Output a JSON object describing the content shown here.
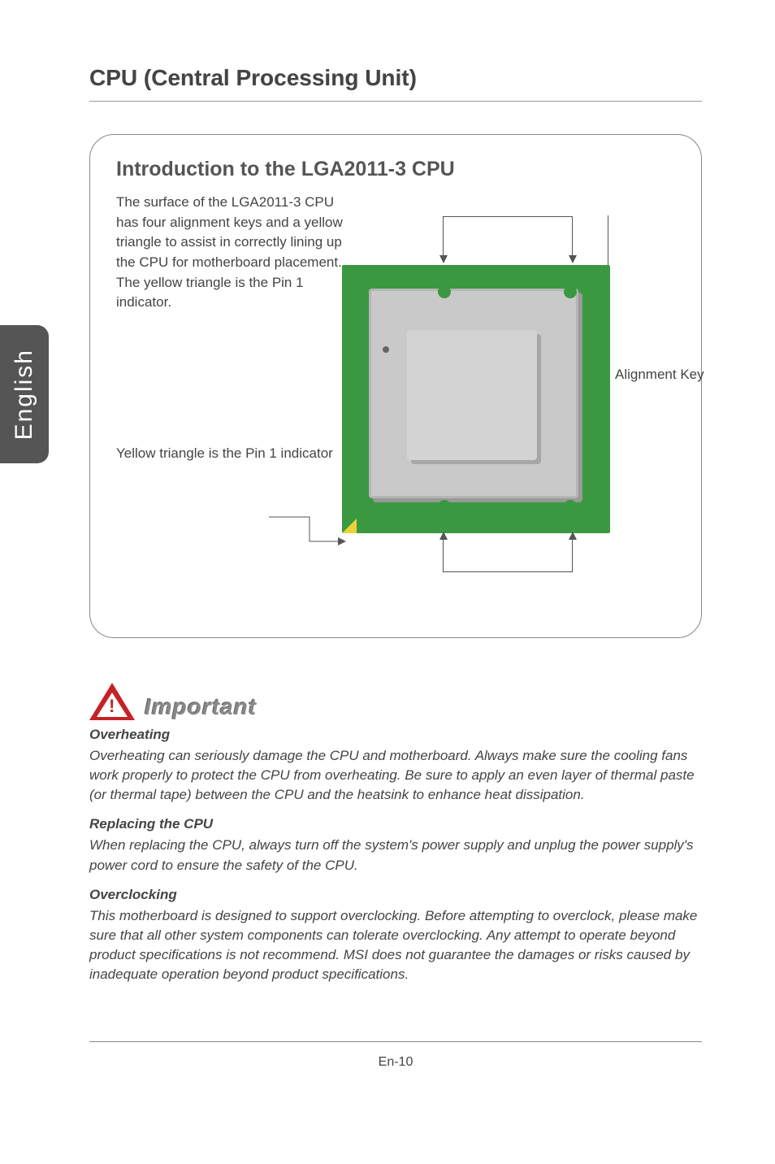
{
  "side_tab": "English",
  "section_title": "CPU (Central Processing Unit)",
  "card": {
    "title": "Introduction to the LGA2011-3 CPU",
    "desc": "The surface of the LGA2011-3 CPU has four alignment keys and a yellow triangle to assist in correctly lining up the CPU for motherboard placement. The yellow triangle is the Pin 1 indicator.",
    "pin_note": "Yellow triangle is the Pin 1 indicator",
    "align_label": "Alignment  Key"
  },
  "important": {
    "header": "Important",
    "sections": [
      {
        "heading": "Overheating",
        "body": "Overheating can seriously damage the CPU and motherboard. Always make sure the cooling fans work properly to protect the CPU from overheating. Be sure to apply an even layer of thermal paste (or thermal tape) between the CPU and the heatsink to enhance heat dissipation."
      },
      {
        "heading": "Replacing the CPU",
        "body": "When replacing the CPU, always turn off the system's power supply and unplug the power supply's power cord to ensure the safety of the CPU."
      },
      {
        "heading": "Overclocking",
        "body": "This motherboard is designed to support overclocking. Before attempting to overclock, please make sure that all other system components can tolerate overclocking. Any attempt to operate beyond product specifications is not recommend. MSI does not guarantee the damages or risks caused by inadequate operation beyond product specifications."
      }
    ]
  },
  "page_number": "En-10"
}
